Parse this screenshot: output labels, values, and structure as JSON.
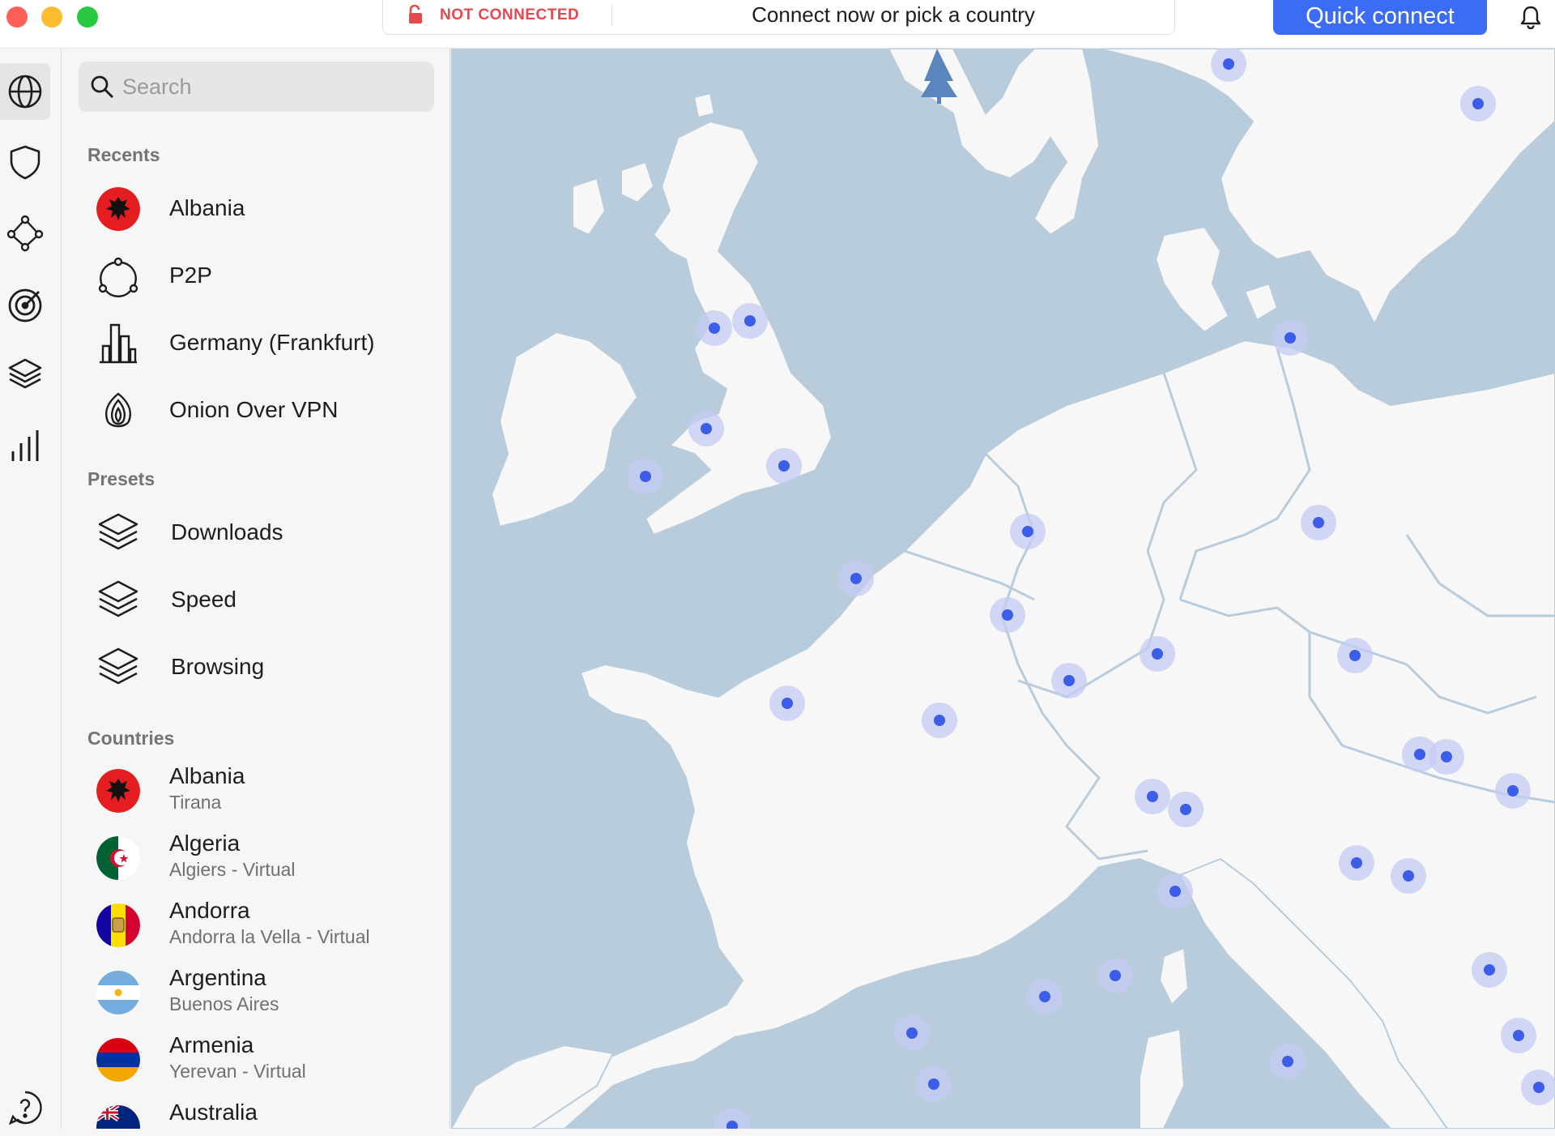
{
  "window": {
    "controls": [
      "close",
      "minimize",
      "zoom"
    ]
  },
  "topbar": {
    "status": "NOT CONNECTED",
    "hint": "Connect now or pick a country",
    "quick_connect": "Quick connect"
  },
  "rail": {
    "items": [
      {
        "icon": "globe-icon",
        "active": true
      },
      {
        "icon": "shield-icon",
        "active": false
      },
      {
        "icon": "meshnet-icon",
        "active": false
      },
      {
        "icon": "target-icon",
        "active": false
      },
      {
        "icon": "layers-icon",
        "active": false
      },
      {
        "icon": "stats-icon",
        "active": false
      }
    ],
    "help_icon": "help-icon"
  },
  "sidebar": {
    "search_placeholder": "Search",
    "recents_title": "Recents",
    "recents": [
      {
        "label": "Albania",
        "icon": "albania-flag"
      },
      {
        "label": "P2P",
        "icon": "p2p-icon"
      },
      {
        "label": "Germany (Frankfurt)",
        "icon": "city-icon"
      },
      {
        "label": "Onion Over VPN",
        "icon": "onion-icon"
      }
    ],
    "presets_title": "Presets",
    "presets": [
      {
        "label": "Downloads",
        "icon": "layers-icon"
      },
      {
        "label": "Speed",
        "icon": "layers-icon"
      },
      {
        "label": "Browsing",
        "icon": "layers-icon"
      }
    ],
    "countries_title": "Countries",
    "countries": [
      {
        "name": "Albania",
        "city": "Tirana"
      },
      {
        "name": "Algeria",
        "city": "Algiers - Virtual"
      },
      {
        "name": "Andorra",
        "city": "Andorra la Vella - Virtual"
      },
      {
        "name": "Argentina",
        "city": "Buenos Aires"
      },
      {
        "name": "Armenia",
        "city": "Yerevan - Virtual"
      },
      {
        "name": "Australia",
        "city": ""
      }
    ]
  },
  "colors": {
    "accent": "#3a6cf4",
    "danger": "#e5484d",
    "sea": "#b9ccdc",
    "land": "#f7f7f7",
    "marker": "#3b5de7"
  }
}
